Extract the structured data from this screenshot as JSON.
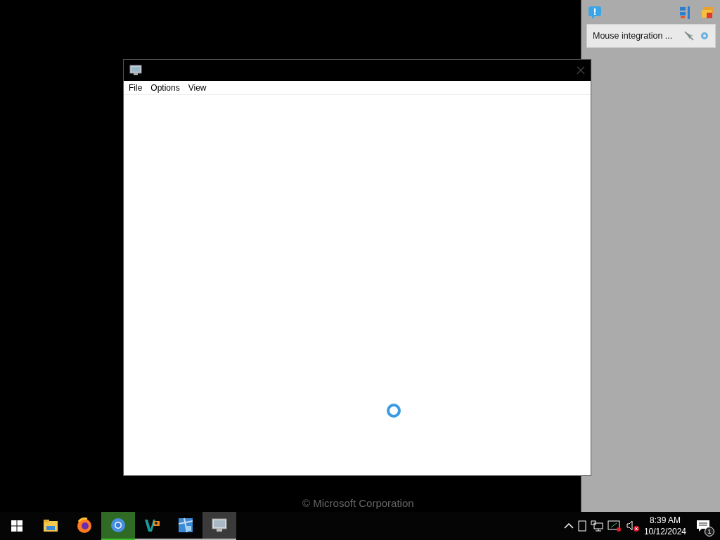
{
  "side_panel": {
    "notice": "Mouse integration ..."
  },
  "window": {
    "menu": [
      "File",
      "Options",
      "View"
    ],
    "loading": true
  },
  "desktop": {
    "footer_text": "© Microsoft Corporation"
  },
  "taskbar": {
    "apps": [
      {
        "kind": "explorer",
        "selected": false,
        "attention": false,
        "running": false
      },
      {
        "kind": "firefox",
        "selected": false,
        "attention": false,
        "running": false
      },
      {
        "kind": "chrome",
        "selected": false,
        "attention": true,
        "running": true
      },
      {
        "kind": "vs",
        "selected": false,
        "attention": false,
        "running": true
      },
      {
        "kind": "tiles",
        "selected": false,
        "attention": false,
        "running": true
      },
      {
        "kind": "remote",
        "selected": true,
        "attention": false,
        "running": true
      }
    ],
    "time": "8:39 AM",
    "date": "10/12/2024",
    "notifications": "1"
  }
}
